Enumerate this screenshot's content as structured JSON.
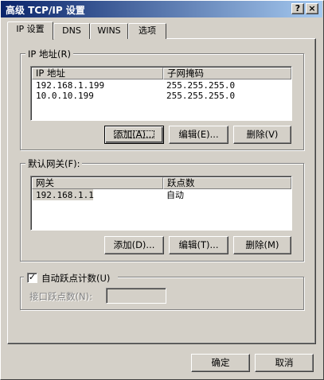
{
  "window": {
    "title": "高级 TCP/IP 设置",
    "help_label": "?",
    "close_label": "×"
  },
  "tabs": [
    {
      "label": "IP 设置"
    },
    {
      "label": "DNS"
    },
    {
      "label": "WINS"
    },
    {
      "label": "选项"
    }
  ],
  "ip_group": {
    "label": "IP 地址(R)",
    "columns": [
      "IP 地址",
      "子网掩码"
    ],
    "rows": [
      [
        "192.168.1.199",
        "255.255.255.0"
      ],
      [
        "10.0.10.199",
        "255.255.255.0"
      ]
    ],
    "buttons": {
      "add": "添加(A)...",
      "edit": "编辑(E)...",
      "delete": "删除(V)"
    }
  },
  "gateway_group": {
    "label": "默认网关(F):",
    "columns": [
      "网关",
      "跃点数"
    ],
    "rows": [
      [
        "192.168.1.1",
        "自动"
      ]
    ],
    "buttons": {
      "add": "添加(D)...",
      "edit": "编辑(T)...",
      "delete": "删除(M)"
    }
  },
  "metric_group": {
    "auto_metric_label": "自动跃点计数(U)",
    "auto_metric_checked": true,
    "check_glyph": "✓",
    "interface_metric_label": "接口跃点数(N):",
    "interface_metric_value": ""
  },
  "footer": {
    "ok_label": "确定",
    "cancel_label": "取消"
  },
  "colors": {
    "face": "#d4d0c8",
    "title_start": "#0a246a",
    "title_end": "#a6caf0"
  }
}
